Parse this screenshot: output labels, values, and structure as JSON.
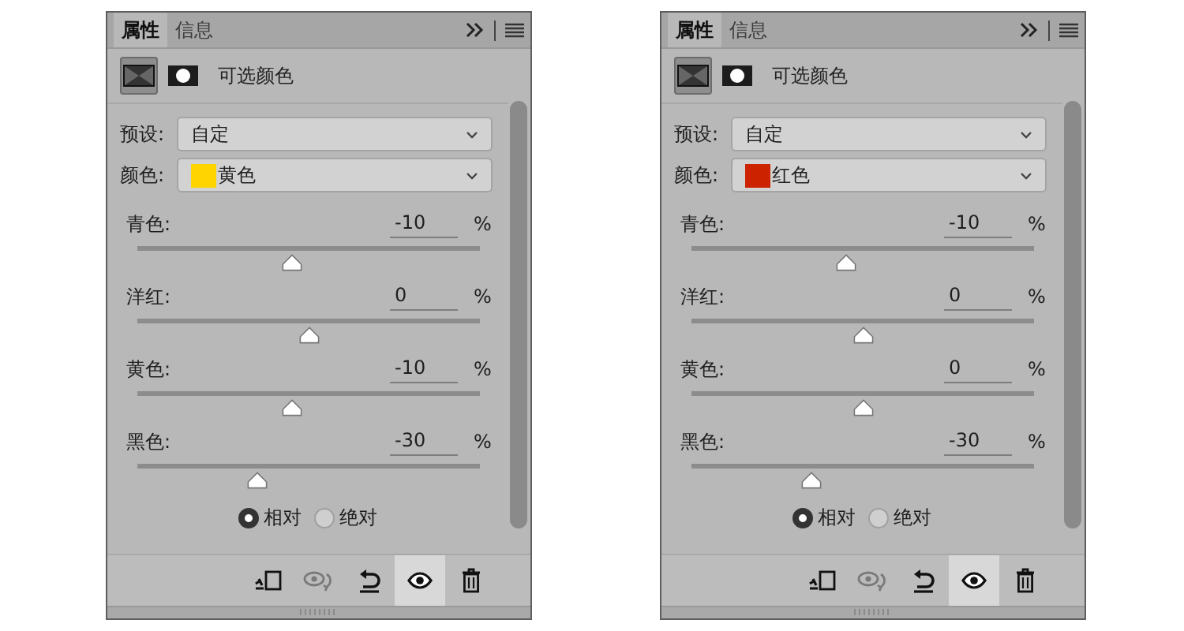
{
  "panels": [
    {
      "tabs": [
        {
          "label": "属性",
          "selected": true
        },
        {
          "label": "信息",
          "selected": false
        }
      ],
      "modes": [
        {
          "kind": "adjustment",
          "selected": true
        },
        {
          "kind": "mask",
          "selected": false
        }
      ],
      "title": "可选颜色",
      "preset": {
        "label": "预设:",
        "value": "自定"
      },
      "color": {
        "label": "颜色:",
        "value": "黄色",
        "color": "#ffd400"
      },
      "sliders": [
        {
          "label": "青色:",
          "value": "-10",
          "unit": "%",
          "level": 0.45
        },
        {
          "label": "洋红:",
          "value": "0",
          "unit": "%",
          "level": 0.5
        },
        {
          "label": "黄色:",
          "value": "-10",
          "unit": "%",
          "level": 0.45
        },
        {
          "label": "黑色:",
          "value": "-30",
          "unit": "%",
          "level": 0.35
        }
      ],
      "method": [
        {
          "label": "相对",
          "selected": true
        },
        {
          "label": "绝对",
          "selected": false
        }
      ],
      "toolbar": [
        {
          "kind": "clip",
          "disabled": false,
          "selected": false
        },
        {
          "kind": "previous",
          "disabled": true,
          "selected": false
        },
        {
          "kind": "reset",
          "disabled": false,
          "selected": false
        },
        {
          "kind": "visibility",
          "disabled": false,
          "selected": true
        },
        {
          "kind": "delete",
          "disabled": false,
          "selected": false
        }
      ]
    },
    {
      "tabs": [
        {
          "label": "属性",
          "selected": true
        },
        {
          "label": "信息",
          "selected": false
        }
      ],
      "modes": [
        {
          "kind": "adjustment",
          "selected": true
        },
        {
          "kind": "mask",
          "selected": false
        }
      ],
      "title": "可选颜色",
      "preset": {
        "label": "预设:",
        "value": "自定"
      },
      "color": {
        "label": "颜色:",
        "value": "红色",
        "color": "#cc2200"
      },
      "sliders": [
        {
          "label": "青色:",
          "value": "-10",
          "unit": "%",
          "level": 0.45
        },
        {
          "label": "洋红:",
          "value": "0",
          "unit": "%",
          "level": 0.5
        },
        {
          "label": "黄色:",
          "value": "0",
          "unit": "%",
          "level": 0.5
        },
        {
          "label": "黑色:",
          "value": "-30",
          "unit": "%",
          "level": 0.35
        }
      ],
      "method": [
        {
          "label": "相对",
          "selected": true
        },
        {
          "label": "绝对",
          "selected": false
        }
      ],
      "toolbar": [
        {
          "kind": "clip",
          "disabled": false,
          "selected": false
        },
        {
          "kind": "previous",
          "disabled": true,
          "selected": false
        },
        {
          "kind": "reset",
          "disabled": false,
          "selected": false
        },
        {
          "kind": "visibility",
          "disabled": false,
          "selected": true
        },
        {
          "kind": "delete",
          "disabled": false,
          "selected": false
        }
      ]
    }
  ]
}
